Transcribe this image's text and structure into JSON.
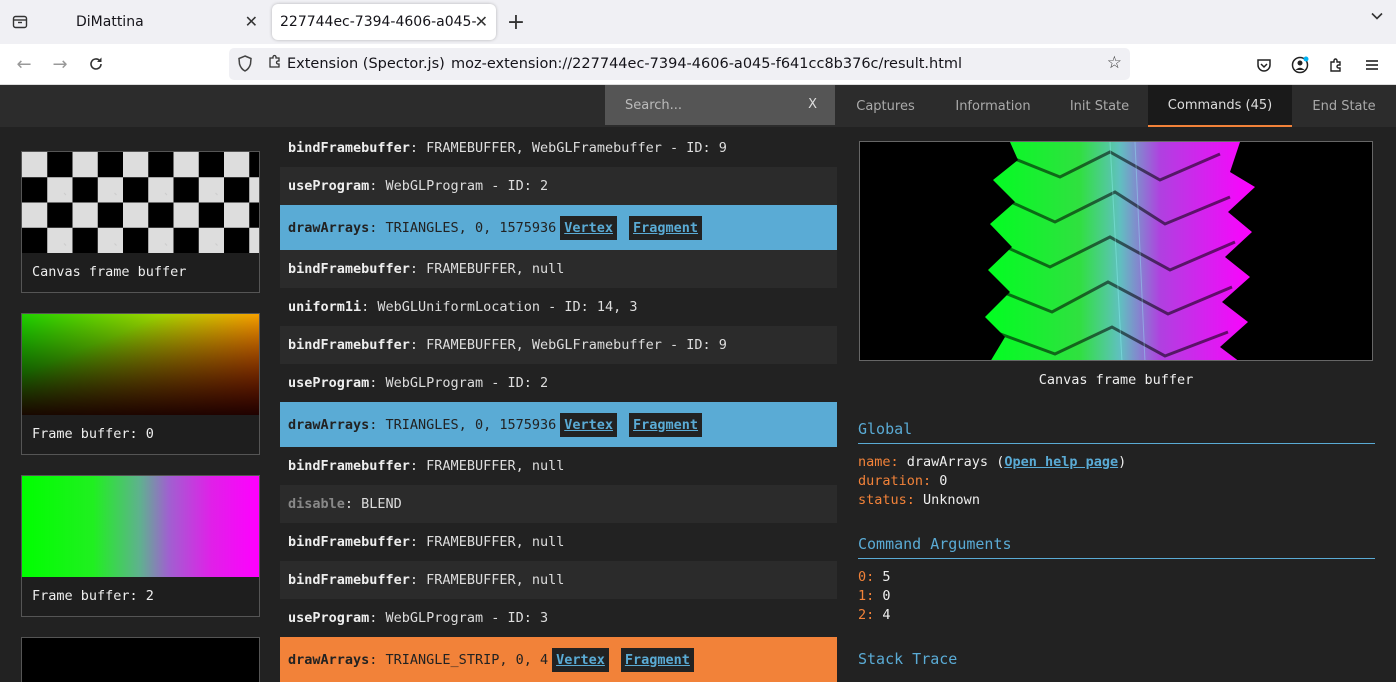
{
  "browser": {
    "tabs": [
      {
        "title": "DiMattina",
        "active": false
      },
      {
        "title": "227744ec-7394-4606-a045-",
        "active": true
      }
    ],
    "new_tab_label": "+",
    "url_identity": "Extension (Spector.js)",
    "url": "moz-extension://227744ec-7394-4606-a045-f641cc8b376c/result.html"
  },
  "app": {
    "search": {
      "placeholder": "Search...",
      "clear_label": "X"
    },
    "tabs": [
      {
        "label": "Captures",
        "active": false
      },
      {
        "label": "Information",
        "active": false
      },
      {
        "label": "Init State",
        "active": false
      },
      {
        "label": "Commands (45)",
        "active": true
      },
      {
        "label": "End State",
        "active": false
      }
    ],
    "thumbnails": [
      {
        "label": "Canvas frame buffer",
        "pattern": "checker"
      },
      {
        "label": "Frame buffer: 0",
        "pattern": "green-yellow-red"
      },
      {
        "label": "Frame buffer: 2",
        "pattern": "green-magenta"
      },
      {
        "label": "",
        "pattern": "black"
      }
    ],
    "commands": [
      {
        "name": "bindFramebuffer",
        "args": ": FRAMEBUFFER, WebGLFramebuffer - ID: 9",
        "style": "odd"
      },
      {
        "name": "useProgram",
        "args": ": WebGLProgram - ID: 2",
        "style": "even"
      },
      {
        "name": "drawArrays",
        "args": ": TRIANGLES, 0, 1575936",
        "style": "blue",
        "vertex": "Vertex",
        "fragment": "Fragment"
      },
      {
        "name": "bindFramebuffer",
        "args": ": FRAMEBUFFER, null",
        "style": "even"
      },
      {
        "name": "uniform1i",
        "args": ": WebGLUniformLocation - ID: 14, 3",
        "style": "odd"
      },
      {
        "name": "bindFramebuffer",
        "args": ": FRAMEBUFFER, WebGLFramebuffer - ID: 9",
        "style": "even"
      },
      {
        "name": "useProgram",
        "args": ": WebGLProgram - ID: 2",
        "style": "odd"
      },
      {
        "name": "drawArrays",
        "args": ": TRIANGLES, 0, 1575936",
        "style": "blue",
        "vertex": "Vertex",
        "fragment": "Fragment"
      },
      {
        "name": "bindFramebuffer",
        "args": ": FRAMEBUFFER, null",
        "style": "odd"
      },
      {
        "name": "disable",
        "args": ": BLEND",
        "style": "even",
        "dim": true
      },
      {
        "name": "bindFramebuffer",
        "args": ": FRAMEBUFFER, null",
        "style": "odd"
      },
      {
        "name": "bindFramebuffer",
        "args": ": FRAMEBUFFER, null",
        "style": "even"
      },
      {
        "name": "useProgram",
        "args": ": WebGLProgram - ID: 3",
        "style": "odd"
      },
      {
        "name": "drawArrays",
        "args": ": TRIANGLE_STRIP, 0, 4",
        "style": "orange",
        "vertex": "Vertex",
        "fragment": "Fragment"
      }
    ],
    "preview_caption": "Canvas frame buffer",
    "global": {
      "title": "Global",
      "name_key": "name:",
      "name_value": "drawArrays",
      "help_link": "Open help page",
      "duration_key": "duration:",
      "duration_value": "0",
      "status_key": "status:",
      "status_value": "Unknown"
    },
    "command_arguments": {
      "title": "Command Arguments",
      "items": [
        {
          "key": "0:",
          "value": "5"
        },
        {
          "key": "1:",
          "value": "0"
        },
        {
          "key": "2:",
          "value": "4"
        }
      ]
    },
    "stack_trace": {
      "title": "Stack Trace"
    },
    "colors": {
      "accent_blue": "#5aabd5",
      "accent_orange": "#f28239",
      "background": "#222222"
    }
  }
}
